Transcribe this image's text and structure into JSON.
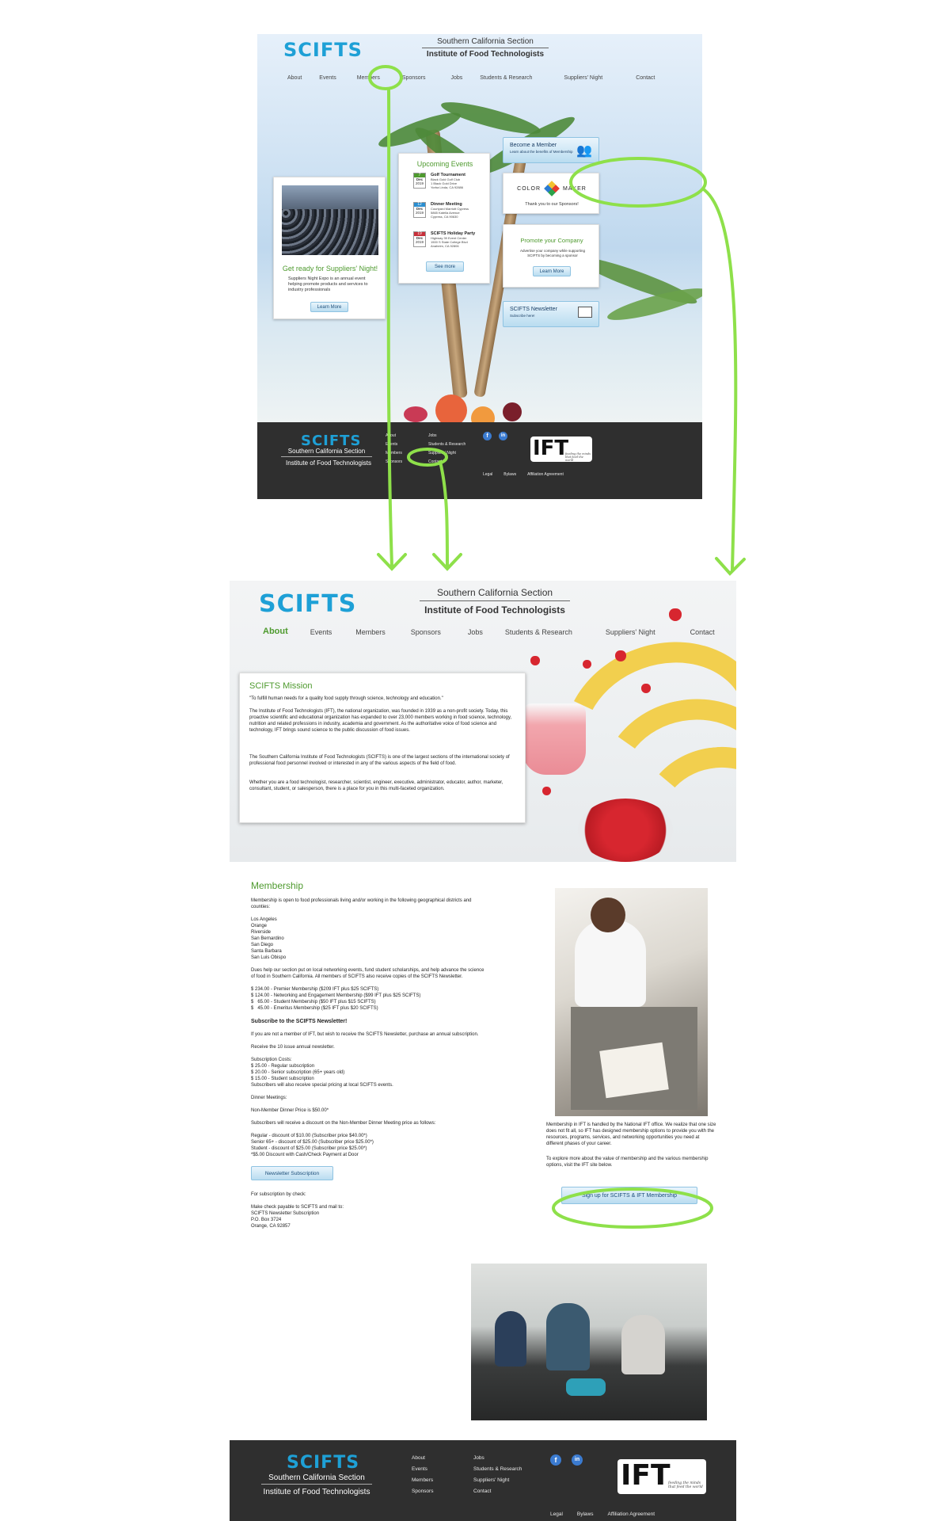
{
  "site": {
    "logo_text": "SCIFTS",
    "section_line": "Southern California Section",
    "org_line": "Institute of Food Technologists"
  },
  "nav": [
    "About",
    "Events",
    "Members",
    "Sponsors",
    "Jobs",
    "Students & Research",
    "Suppliers' Night",
    "Contact"
  ],
  "home": {
    "suppliers_card": {
      "headline": "Get ready for Suppliers' Night!",
      "body": "Suppliers Night Expo is an annual event helping promote products and services to industry professionals",
      "button": "Learn More"
    },
    "events_card": {
      "title": "Upcoming Events",
      "events": [
        {
          "day": "7",
          "month": "Dec",
          "year": "2019",
          "name": "Golf Tournament",
          "lines": [
            "Black Gold Golf Club",
            "1 Black Gold Drive",
            "Yorba Linda, CA 92886"
          ],
          "color": "#4e9a2e"
        },
        {
          "day": "12",
          "month": "Dec",
          "year": "2019",
          "name": "Dinner Meeting",
          "lines": [
            "Courtyard Marriott Cypress",
            "5865 Katella Avenue",
            "Cypress, CA 90630"
          ],
          "color": "#2b8ed0"
        },
        {
          "day": "19",
          "month": "Dec",
          "year": "2019",
          "name": "SCIFTS Holiday Party",
          "lines": [
            "Highway 39 Event Center",
            "1500 S State College Blvd",
            "Anaheim, CA 92806"
          ],
          "color": "#c7303a"
        }
      ],
      "button": "See more"
    },
    "member_box": {
      "title": "Become a Member",
      "sub": "Learn about the benefits of Membership"
    },
    "sponsor_box": {
      "brand_left": "COLOR",
      "brand_right": "MAKER",
      "thanks": "Thank you to our Sponsors!"
    },
    "promote_box": {
      "title": "Promote your Company",
      "body": "Advertise your company while supporting SCIFTS by becoming a sponsor",
      "button": "Learn More"
    },
    "newsletter_box": {
      "title": "SCIFTS Newsletter",
      "sub": "Subscribe here!"
    }
  },
  "footer": {
    "col1": [
      "About",
      "Events",
      "Members",
      "Sponsors"
    ],
    "col2": [
      "Jobs",
      "Students & Research",
      "Suppliers' Night",
      "Contact"
    ],
    "bottom_links": [
      "Legal",
      "Bylaws",
      "Affiliation Agreement"
    ],
    "social": [
      "f",
      "in"
    ],
    "ift_logo": "IFT",
    "ift_tagline": "feeding the minds that feed the world"
  },
  "about": {
    "mission_title": "SCIFTS Mission",
    "mission_quote": "\"To fulfill human needs for a quality food supply through science, technology and education.\"",
    "mission_p1": "The Institute of Food Technologists (IFT), the national organization, was founded in 1939 as a non-profit society. Today, this proactive scientific and educational organization has expanded to over 23,000 members working in food science, technology, nutrition and related professions in industry, academia and government. As the authoritative voice of food science and technology, IFT brings sound science to the public discussion of food issues.",
    "mission_p2": "The Southern California Institute of Food Technologists (SCIFTS) is one of the largest sections of the international society of professional food personnel involved or interested in any of the various aspects of the field of food.",
    "mission_p3": "Whether you are a food technologist, researcher, scientist, engineer, executive, administrator, educator, author, marketer, consultant, student, or salesperson, there is a place for you in this multi-faceted organization.",
    "membership_title": "Membership",
    "membership_intro": "Membership is open to food professionals living and/or working in the following geographical districts and counties:",
    "counties": [
      "Los Angeles",
      "Orange",
      "Riverside",
      "San Bernardino",
      "San Diego",
      "Santa Barbara",
      "San Luis Obispo"
    ],
    "dues_text": "Dues help our section put on local networking events, fund student scholarships, and help advance the science of food in Southern California. All members of SCIFTS also receive copies of the SCIFTS Newsletter.",
    "prices": [
      "$ 234.00 - Premier Membership ($209 IFT plus $25 SCIFTS)",
      "$ 124.00 - Networking and Engagement Membership ($99 IFT plus $25 SCIFTS)",
      "$   65.00 - Student Membership ($50 IFT plus $15 SCIFTS)",
      "$   45.00 - Emeritus Membership ($25 IFT plus $20 SCIFTS)"
    ],
    "subscribe_title": "Subscribe to the SCIFTS Newsletter!",
    "subscribe_p1": "If you are not a member of IFT, but wish to receive the SCIFTS Newsletter, purchase an annual subscription.",
    "subscribe_p2": "Receive the 10 issue annual newsletter.",
    "costs_head": "Subscription Costs:",
    "costs": [
      "$ 25.00 - Regular subscription",
      "$ 20.00 - Senior subscription (65+ years old)",
      "$ 15.00 - Student subscription",
      "Subscribers will also receive special pricing at local SCIFTS events."
    ],
    "dinner_head": "Dinner Meetings:",
    "dinner_price": "Non-Member Dinner Price is $50.00*",
    "dinner_p": "Subscribers will receive a discount on the Non-Member Dinner Meeting price as follows:",
    "discounts": [
      "Regular - discount of $10.00 (Subscriber price $40.00*)",
      "Senior 65+ - discount of $25.00 (Subscriber price $25.00*)",
      "Student - discount of $25.00 (Subscriber price $25.00*)",
      "*$5.00 Discount with Cash/Check Payment at Door"
    ],
    "newsletter_button": "Newsletter Subscription",
    "check_head": "For subscription by check:",
    "check_lines": [
      "Make check payable to SCIFTS and mail to:",
      "SCIFTS Newsletter Subscription",
      "P.O. Box 3724",
      "Orange, CA 92857"
    ],
    "ift_text1": "Membership in IFT is handled by the National IFT office. We realize that one size does not fit all, so IFT has designed membership options to provide you with the resources, programs, services, and networking opportunities you need at different phases of your career.",
    "ift_text2": "To explore more about the value of membership and the various membership options, visit the IFT site below.",
    "signup_button": "Sign up for SCIFTS & IFT Membership"
  },
  "colors": {
    "accent_green": "#4e9a2e",
    "logo_blue": "#1ea0d6",
    "annotation": "#8ee04a",
    "footer_bg": "#2f2f2f"
  }
}
